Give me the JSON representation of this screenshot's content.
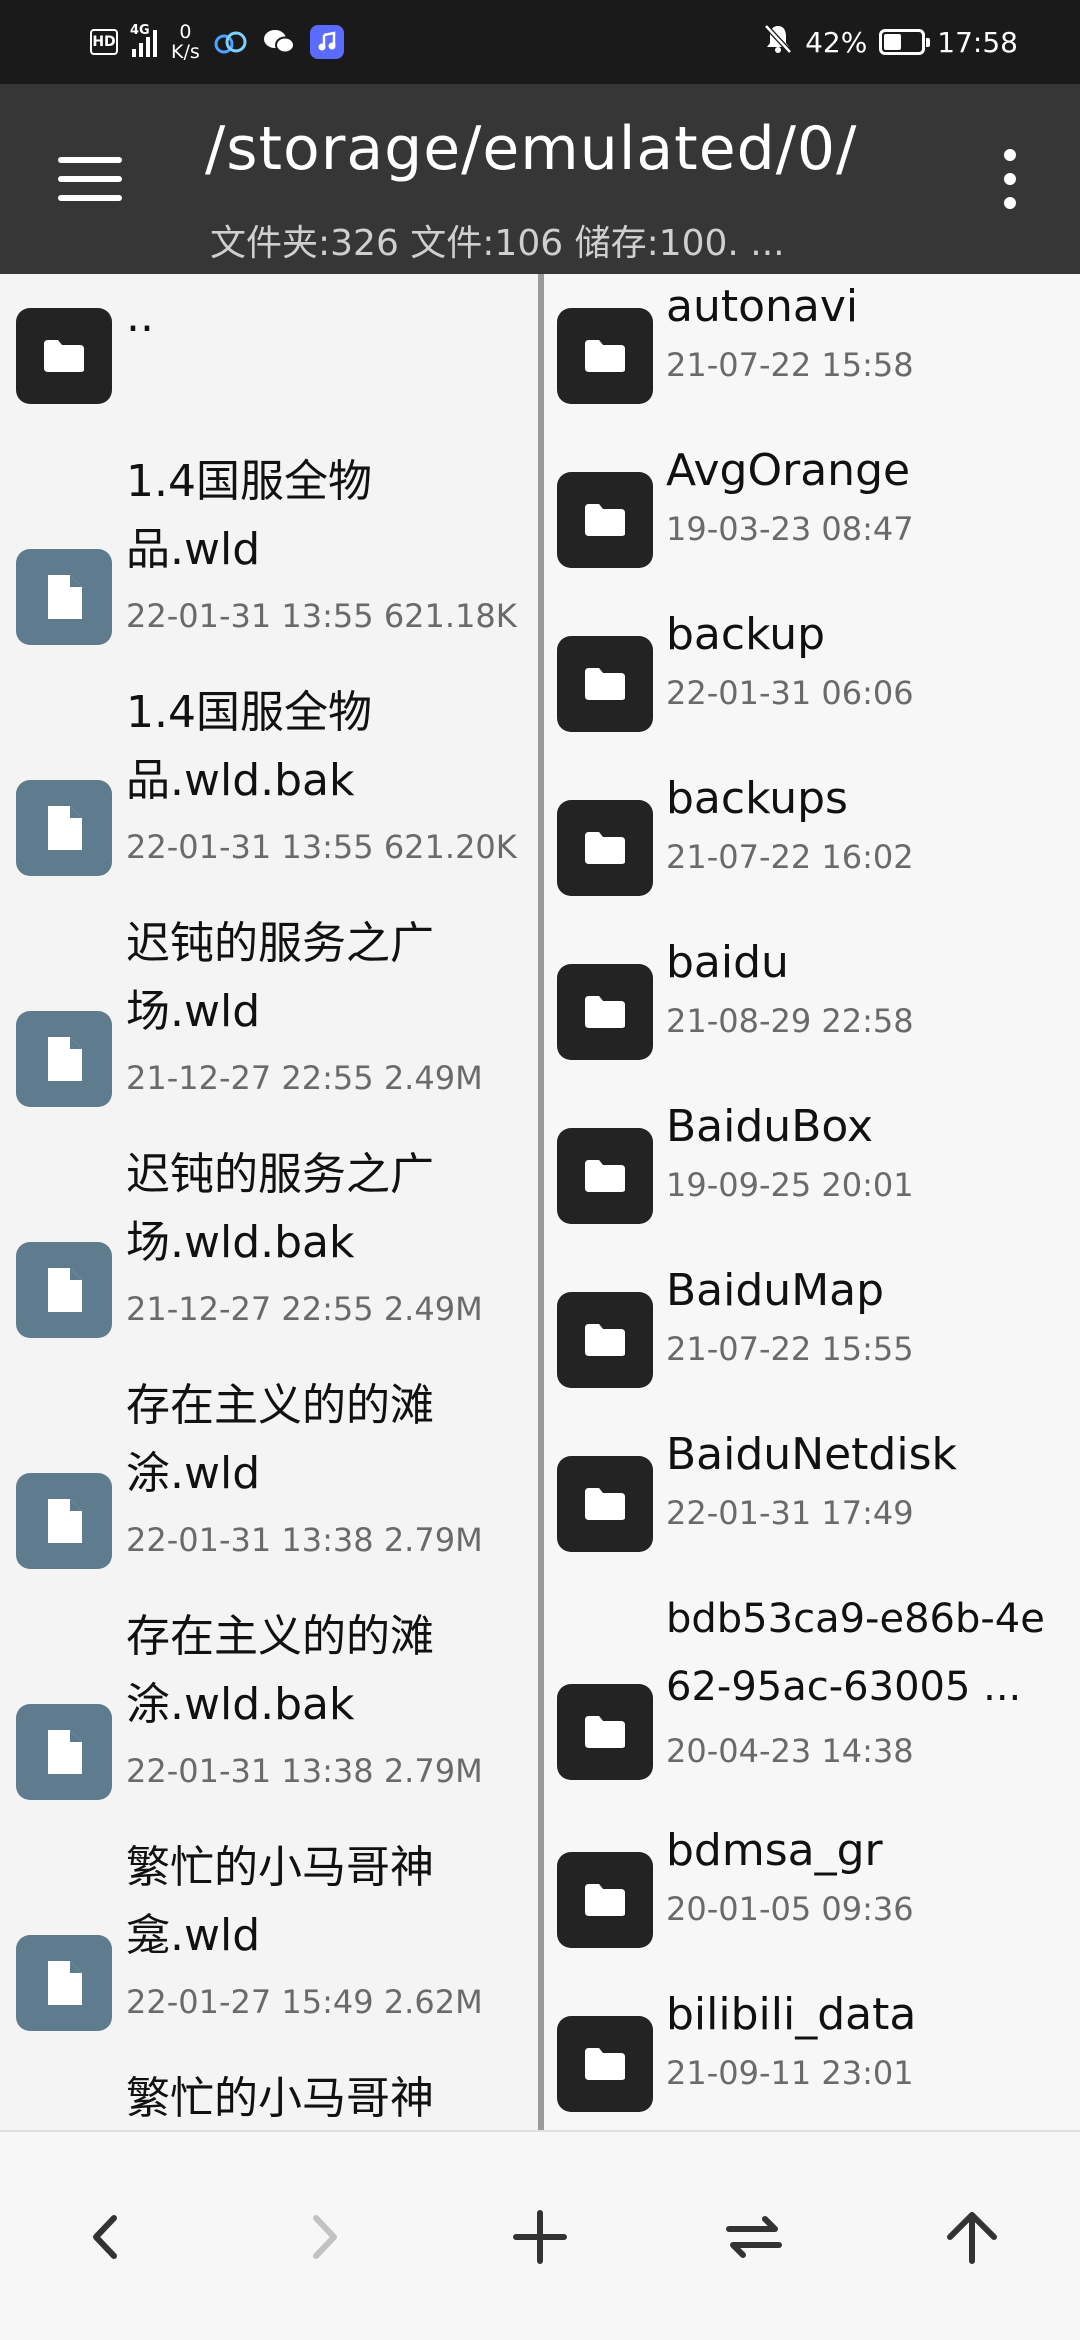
{
  "status_bar": {
    "hd": "HD",
    "network": "4G",
    "speed_value": "0",
    "speed_unit": "K/s",
    "battery_percent": "42%",
    "time": "17:58",
    "icons": [
      "hd-icon",
      "signal-icon",
      "cloud-app-icon",
      "wechat-icon",
      "music-app-icon",
      "mute-bell-icon",
      "battery-icon"
    ]
  },
  "toolbar": {
    "path": "/storage/emulated/0/",
    "summary": "文件夹:326  文件:106  储存:100. ..."
  },
  "left_pane": {
    "items": [
      {
        "name": "..",
        "line1": "..",
        "line2": "",
        "meta": "",
        "type": "folder"
      },
      {
        "name": "1.4国服全物品.wld",
        "line1": "1.4国服全物",
        "line2": "品.wld",
        "meta": "22-01-31 13:55  621.18K",
        "type": "file"
      },
      {
        "name": "1.4国服全物品.wld.bak",
        "line1": "1.4国服全物",
        "line2": "品.wld.bak",
        "meta": "22-01-31 13:55  621.20K",
        "type": "file"
      },
      {
        "name": "迟钝的服务之广场.wld",
        "line1": "迟钝的服务之广",
        "line2": "场.wld",
        "meta": "21-12-27 22:55  2.49M",
        "type": "file"
      },
      {
        "name": "迟钝的服务之广场.wld.bak",
        "line1": "迟钝的服务之广",
        "line2": "场.wld.bak",
        "meta": "21-12-27 22:55  2.49M",
        "type": "file"
      },
      {
        "name": "存在主义的的滩涂.wld",
        "line1": "存在主义的的滩",
        "line2": "涂.wld",
        "meta": "22-01-31 13:38  2.79M",
        "type": "file"
      },
      {
        "name": "存在主义的的滩涂.wld.bak",
        "line1": "存在主义的的滩",
        "line2": "涂.wld.bak",
        "meta": "22-01-31 13:38  2.79M",
        "type": "file"
      },
      {
        "name": "繁忙的小马哥神龛.wld",
        "line1": "繁忙的小马哥神",
        "line2": "龛.wld",
        "meta": "22-01-27 15:49  2.62M",
        "type": "file"
      },
      {
        "name": "繁忙的小马哥神",
        "line1": "繁忙的小马哥神",
        "line2": "",
        "meta": "",
        "type": "file"
      }
    ]
  },
  "right_pane": {
    "items": [
      {
        "line1": "autonavi",
        "line2": "",
        "meta": "21-07-22 15:58"
      },
      {
        "line1": "AvgOrange",
        "line2": "",
        "meta": "19-03-23 08:47"
      },
      {
        "line1": "backup",
        "line2": "",
        "meta": "22-01-31 06:06"
      },
      {
        "line1": "backups",
        "line2": "",
        "meta": "21-07-22 16:02"
      },
      {
        "line1": "baidu",
        "line2": "",
        "meta": "21-08-29 22:58"
      },
      {
        "line1": "BaiduBox",
        "line2": "",
        "meta": "19-09-25 20:01"
      },
      {
        "line1": "BaiduMap",
        "line2": "",
        "meta": "21-07-22 15:55"
      },
      {
        "line1": "BaiduNetdisk",
        "line2": "",
        "meta": "22-01-31 17:49"
      },
      {
        "line1": "bdb53ca9-e86b-4e",
        "line2": "62-95ac-63005 ...",
        "meta": "20-04-23 14:38"
      },
      {
        "line1": "bdmsa_gr",
        "line2": "",
        "meta": "20-01-05 09:36"
      },
      {
        "line1": "bilibili_data",
        "line2": "",
        "meta": "21-09-11 23:01"
      }
    ]
  },
  "bottom_bar": {
    "buttons": [
      "back-icon",
      "forward-icon",
      "add-icon",
      "swap-icon",
      "up-icon"
    ]
  },
  "colors": {
    "status_bar": "#1a1a1a",
    "toolbar": "#363636",
    "folder_icon": "#232323",
    "file_icon": "#5f7b8e"
  }
}
